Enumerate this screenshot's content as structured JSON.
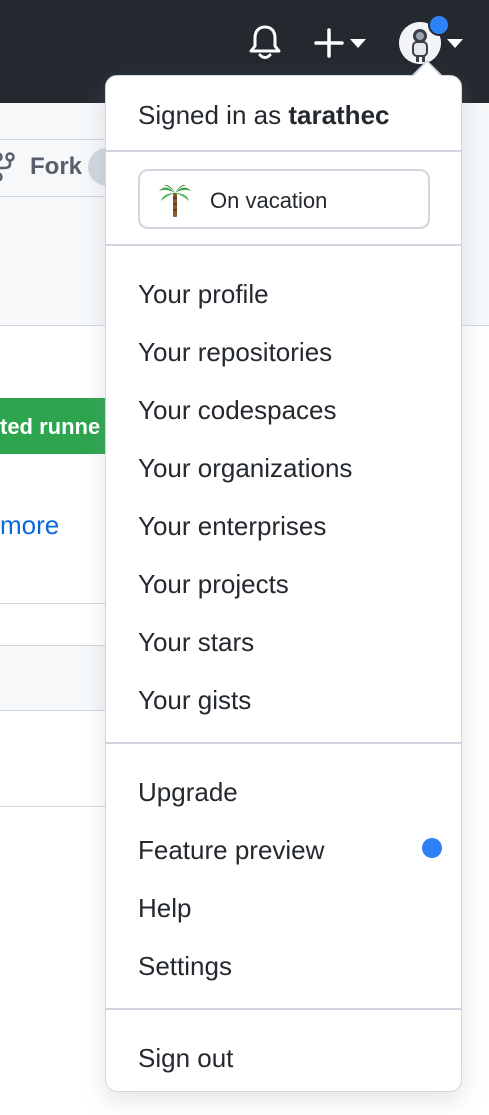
{
  "header": {
    "icons": [
      "bell-icon",
      "plus-icon",
      "caret-down-icon",
      "avatar"
    ],
    "notification_color": "#2f81f7"
  },
  "background": {
    "fork_label": "Fork",
    "green_button_text": "ted runne",
    "link_text": "more"
  },
  "dropdown": {
    "signed_in_prefix": "Signed in as ",
    "username": "tarathec",
    "status": {
      "icon": "palm-tree-icon",
      "label": "On vacation"
    },
    "primary_items": [
      "Your profile",
      "Your repositories",
      "Your codespaces",
      "Your organizations",
      "Your enterprises",
      "Your projects",
      "Your stars",
      "Your gists"
    ],
    "secondary_items": [
      "Upgrade",
      "Feature preview",
      "Help",
      "Settings"
    ],
    "sign_out": "Sign out"
  }
}
